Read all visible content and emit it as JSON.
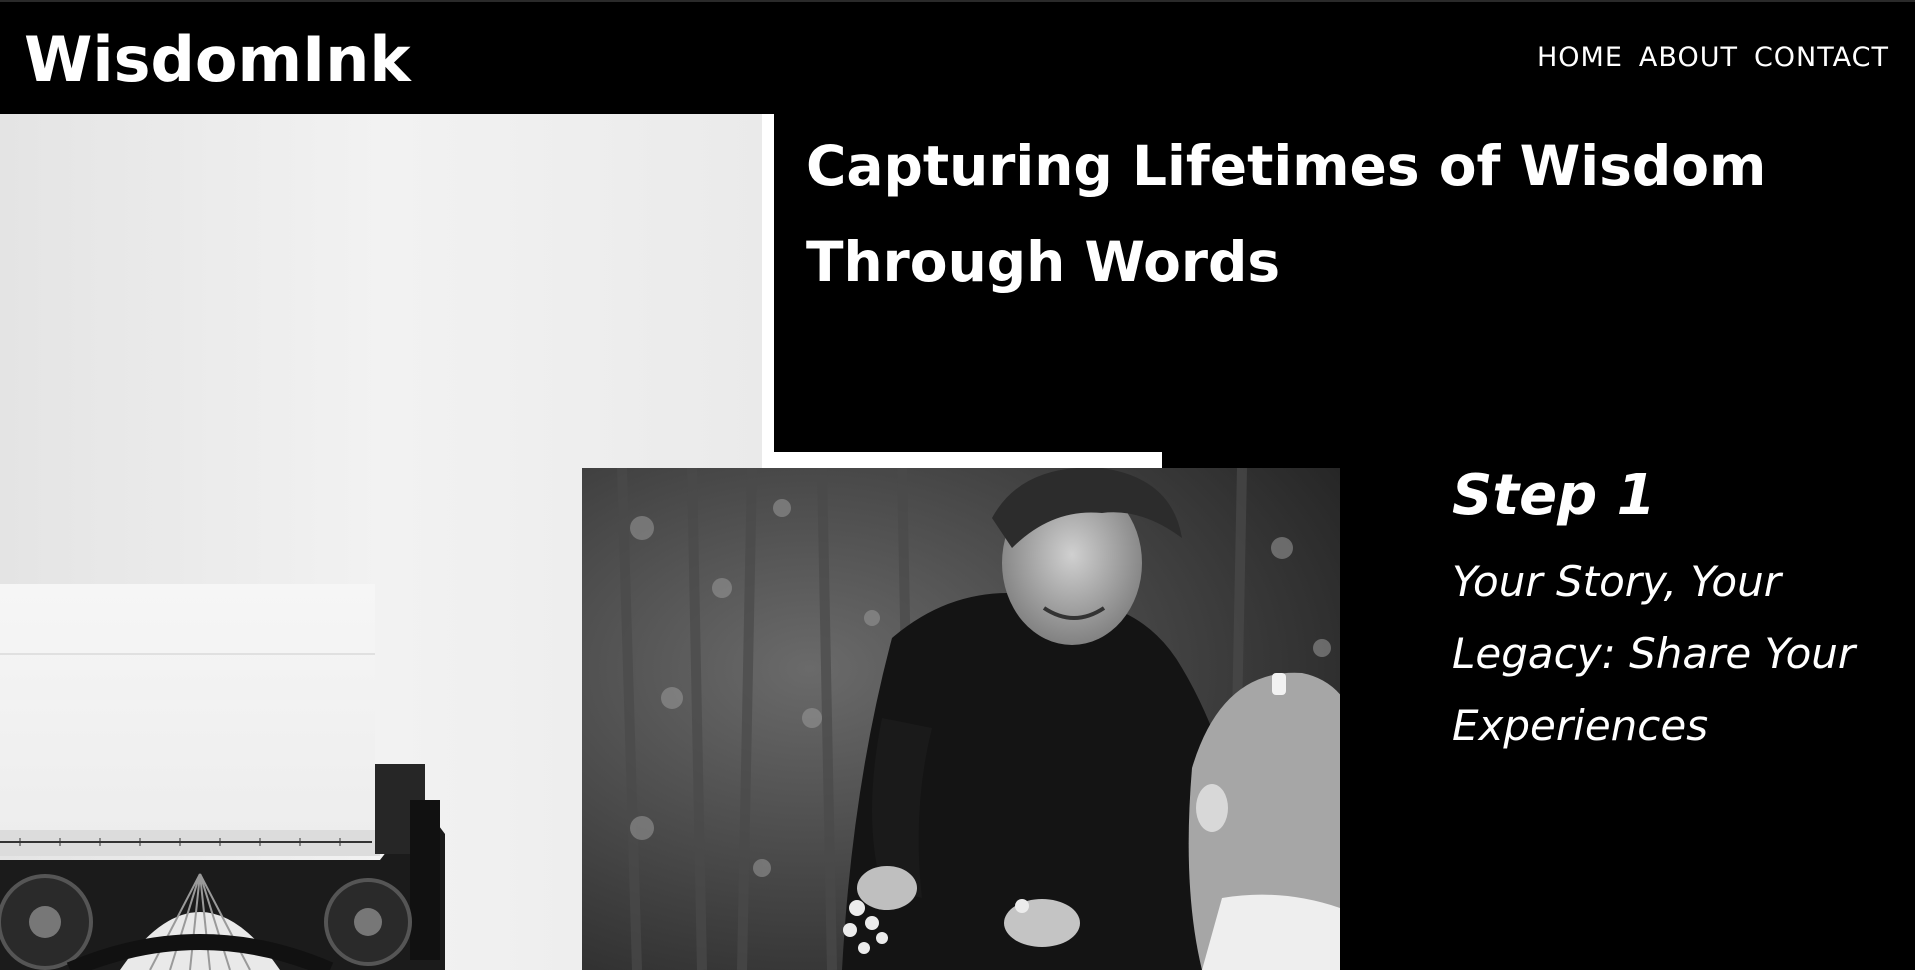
{
  "header": {
    "logo": "WisdomInk",
    "nav": [
      "HOME",
      "ABOUT",
      "CONTACT"
    ]
  },
  "hero": {
    "title_line1": "Capturing Lifetimes of Wisdom",
    "title_line2": "Through Words"
  },
  "images": {
    "left": "typewriter-photo",
    "center": "grandmother-and-child-photo"
  },
  "step": {
    "heading": "Step 1",
    "text_line1": "Your Story, Your",
    "text_line2": "Legacy: Share Your",
    "text_line3": "Experiences"
  },
  "colors": {
    "background": "#000000",
    "text": "#ffffff",
    "accent": "#ffffff"
  }
}
